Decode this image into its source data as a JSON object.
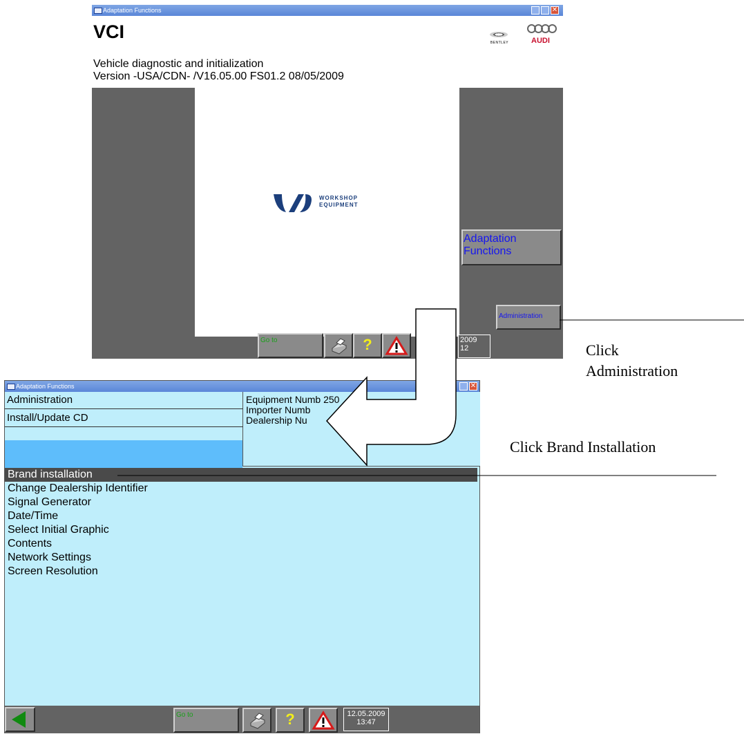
{
  "window1": {
    "title": "Adaptation Functions",
    "app_title": "VCI",
    "subtitle": "Vehicle diagnostic and initialization",
    "version": "Version -USA/CDN- /V16.05.00 FS01.2  08/05/2009",
    "bentley_label": "BENTLEY",
    "audi_label": "AUDI",
    "workshop_logo_line1": "WORKSHOP",
    "workshop_logo_line2": "EQUIPMENT",
    "adaptation_button": "Adaptation Functions",
    "administration_button": "Administration",
    "goto_button": "Go to",
    "date_line1": "2009",
    "date_line2": "12"
  },
  "window2": {
    "title": "Adaptation Functions",
    "menu": [
      "Administration",
      "Install/Update CD"
    ],
    "info": {
      "equipment": "Equipment Numb",
      "equipment_value": "250",
      "importer": "Importer Numb",
      "dealership": "Dealership Nu"
    },
    "list": [
      "Brand installation",
      "Change Dealership Identifier",
      "Signal Generator",
      "Date/Time",
      "Select Initial Graphic",
      "Contents",
      "Network Settings",
      "Screen Resolution"
    ],
    "selected_index": 0,
    "goto_button": "Go to",
    "date": "12.05.2009",
    "time": "13:47"
  },
  "annotations": {
    "click_admin_line1": "Click",
    "click_admin_line2": "Administration",
    "click_brand": "Click Brand Installation"
  },
  "colors": {
    "panel_bg": "#bfeefb",
    "gray_bg": "#636363",
    "button_text": "#1515f0",
    "goto_text": "#19a019",
    "selected_bg": "#4a4a4a",
    "menu_blue": "#5ebdfb"
  }
}
